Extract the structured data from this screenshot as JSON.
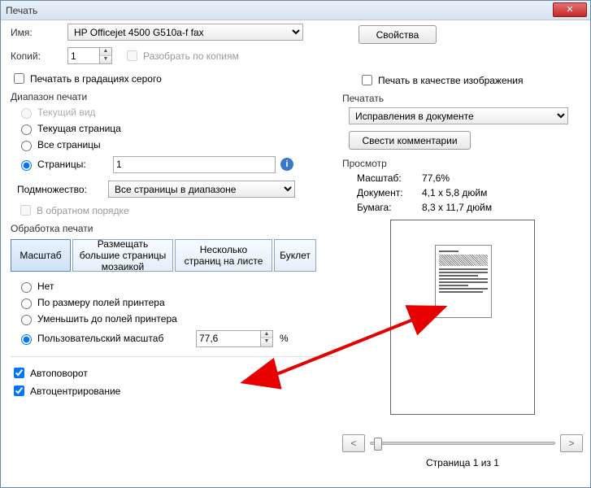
{
  "window": {
    "title": "Печать"
  },
  "name": {
    "label": "Имя:",
    "value": "HP Officejet 4500 G510a-f fax"
  },
  "properties_btn": "Свойства",
  "copies": {
    "label": "Копий:",
    "value": "1"
  },
  "collate": "Разобрать по копиям",
  "grayscale": "Печатать в градациях серого",
  "print_as_image": "Печать в качестве изображения",
  "range": {
    "title": "Диапазон печати",
    "current_view": "Текущий вид",
    "current_page": "Текущая страница",
    "all_pages": "Все страницы",
    "pages": "Страницы:",
    "pages_value": "1",
    "subset_label": "Подмножество:",
    "subset_value": "Все страницы в диапазоне",
    "reverse": "В обратном порядке"
  },
  "handling": {
    "title": "Обработка печати",
    "tab_scale": "Масштаб",
    "tab_tile": "Размещать большие страницы мозаикой",
    "tab_multi": "Несколько страниц на листе",
    "tab_booklet": "Буклет",
    "opt_none": "Нет",
    "opt_fit": "По размеру полей принтера",
    "opt_shrink": "Уменьшить до полей принтера",
    "opt_custom": "Пользовательский масштаб",
    "custom_value": "77,6",
    "percent": "%"
  },
  "auto_rotate": "Автоповорот",
  "auto_center": "Автоцентрирование",
  "print_what": {
    "title": "Печатать",
    "value": "Исправления в документе"
  },
  "flatten_btn": "Свести комментарии",
  "preview": {
    "title": "Просмотр",
    "zoom_label": "Масштаб:",
    "zoom_value": "77,6%",
    "doc_label": "Документ:",
    "doc_value": "4,1 x 5,8 дюйм",
    "paper_label": "Бумага:",
    "paper_value": "8,3 x 11,7 дюйм",
    "page_of": "Страница 1 из 1"
  }
}
